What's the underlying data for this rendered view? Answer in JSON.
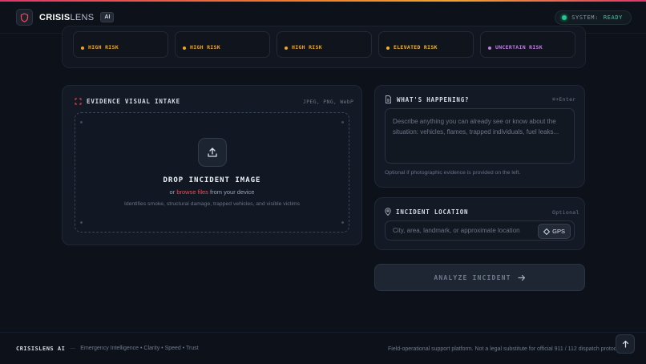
{
  "header": {
    "brand_bold": "CRISIS",
    "brand_light": "LENS",
    "badge": "AI",
    "status_label": "SYSTEM:",
    "status_value": "READY"
  },
  "risk_cards": [
    {
      "label": "HIGH RISK",
      "color": "#f2a520"
    },
    {
      "label": "HIGH RISK",
      "color": "#f2a520"
    },
    {
      "label": "HIGH RISK",
      "color": "#f2a520"
    },
    {
      "label": "ELEVATED RISK",
      "color": "#f2b22c"
    },
    {
      "label": "UNCERTAIN RISK",
      "color": "#c27de6"
    }
  ],
  "evidence": {
    "title": "EVIDENCE VISUAL INTAKE",
    "formats": "JPEG, PNG, WebP",
    "drop_title": "DROP INCIDENT IMAGE",
    "or": "or",
    "browse": "browse files",
    "from_device": "from your device",
    "description": "Identifies smoke, structural damage, trapped vehicles, and visible victims"
  },
  "happening": {
    "title": "WHAT'S HAPPENING?",
    "shortcut": "⌘+Enter",
    "placeholder": "Describe anything you can already see or know about the situation: vehicles, flames, trapped individuals, fuel leaks...",
    "note": "Optional if photographic evidence is provided on the left."
  },
  "location": {
    "title": "INCIDENT LOCATION",
    "optional": "Optional",
    "placeholder": "City, area, landmark, or approximate location",
    "gps_label": "GPS"
  },
  "analyze_label": "ANALYZE INCIDENT",
  "footer": {
    "brand": "CRISISLENS AI",
    "dash": "—",
    "tagline": "Emergency Intelligence • Clarity • Speed • Trust",
    "disclaimer": "Field-operational support platform. Not a legal substitute for official 911 / 112 dispatch protocols."
  },
  "colors": {
    "accent_red": "#ef4b55",
    "status_green": "#22c58b"
  },
  "icons": [
    "shield-icon",
    "scan-icon",
    "document-icon",
    "upload-icon",
    "map-pin-icon",
    "crosshair-icon",
    "arrow-right-icon",
    "arrow-up-icon"
  ]
}
